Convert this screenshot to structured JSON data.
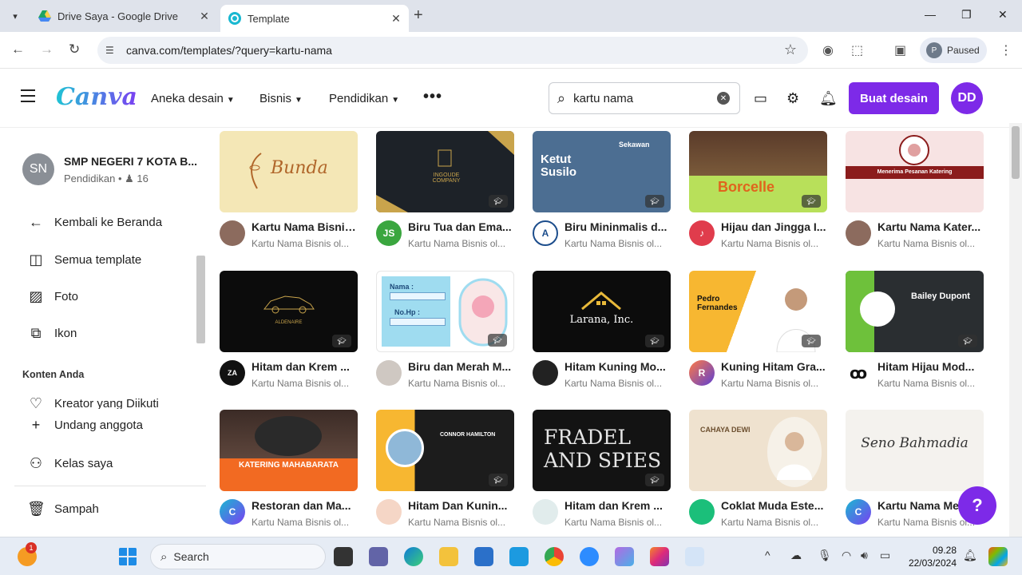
{
  "browser": {
    "tabs": [
      {
        "title": "Drive Saya - Google Drive",
        "active": false
      },
      {
        "title": "Template",
        "active": true
      }
    ],
    "url": "canva.com/templates/?query=kartu-nama",
    "profile_label": "Paused",
    "profile_initial": "P"
  },
  "header": {
    "logo": "Canva",
    "nav": [
      "Aneka desain",
      "Bisnis",
      "Pendidikan"
    ],
    "search_value": "kartu nama",
    "create_button": "Buat desain",
    "avatar_initials": "DD",
    "accent": "#7d2ae8"
  },
  "sidebar": {
    "team": {
      "initials": "SN",
      "name": "SMP NEGERI 7 KOTA B...",
      "type": "Pendidikan",
      "members": "16"
    },
    "items": [
      {
        "label": "Kembali ke Beranda",
        "icon": "arrow-left-icon"
      },
      {
        "label": "Semua template",
        "icon": "template-icon"
      },
      {
        "label": "Foto",
        "icon": "image-icon"
      },
      {
        "label": "Ikon",
        "icon": "shapes-icon"
      }
    ],
    "section_heading": "Konten Anda",
    "section_items": [
      {
        "label": "Kreator yang Diikuti",
        "icon": "heart-hands-icon"
      }
    ],
    "bottom_items": [
      {
        "label": "Undang anggota",
        "icon": "plus-icon"
      },
      {
        "label": "Kelas saya",
        "icon": "people-icon"
      },
      {
        "label": "Sampah",
        "icon": "trash-icon"
      }
    ]
  },
  "templates": [
    {
      "title": "Kartu Nama Bisnis...",
      "subtitle": "Kartu Nama Bisnis ol...",
      "thumb_text": "Bunda"
    },
    {
      "title": "Biru Tua dan Ema...",
      "subtitle": "Kartu Nama Bisnis ol...",
      "thumb_text": "INGOUDE COMPANY",
      "avatar": "JS"
    },
    {
      "title": "Biru Mininmalis d...",
      "subtitle": "Kartu Nama Bisnis ol...",
      "thumb_text": "Ketut Susilo",
      "thumb_text2": "Sekawan"
    },
    {
      "title": "Hijau dan Jingga I...",
      "subtitle": "Kartu Nama Bisnis ol...",
      "thumb_text": "Borcelle"
    },
    {
      "title": "Kartu Nama Kater...",
      "subtitle": "Kartu Nama Bisnis ol...",
      "thumb_text": "Menerima Pesanan Katering"
    },
    {
      "title": "Hitam dan Krem ...",
      "subtitle": "Kartu Nama Bisnis ol...",
      "thumb_text": "ALDENAIRE"
    },
    {
      "title": "Biru dan Merah M...",
      "subtitle": "Kartu Nama Bisnis ol...",
      "thumb_text": "Nama :",
      "thumb_text2": "No.Hp :"
    },
    {
      "title": "Hitam Kuning Mo...",
      "subtitle": "Kartu Nama Bisnis ol...",
      "thumb_text": "Larana, Inc."
    },
    {
      "title": "Kuning Hitam Gra...",
      "subtitle": "Kartu Nama Bisnis ol...",
      "thumb_text": "Pedro Fernandes"
    },
    {
      "title": "Hitam Hijau Mod...",
      "subtitle": "Kartu Nama Bisnis ol...",
      "thumb_text": "Bailey Dupont"
    },
    {
      "title": "Restoran dan Ma...",
      "subtitle": "Kartu Nama Bisnis ol...",
      "thumb_text": "KATERING MAHABARATA"
    },
    {
      "title": "Hitam Dan Kunin...",
      "subtitle": "Kartu Nama Bisnis ol...",
      "thumb_text": "CONNOR HAMILTON"
    },
    {
      "title": "Hitam dan Krem ...",
      "subtitle": "Kartu Nama Bisnis ol...",
      "thumb_text": "FRADEL AND SPIES"
    },
    {
      "title": "Coklat Muda Este...",
      "subtitle": "Kartu Nama Bisnis ol...",
      "thumb_text": "CAHAYA DEWI"
    },
    {
      "title": "Kartu Nama Me...",
      "subtitle": "Kartu Nama Bisnis ol...",
      "thumb_text": "Seno Bahmadia"
    }
  ],
  "help_label": "?",
  "taskbar": {
    "search_placeholder": "Search",
    "time": "09.28",
    "date": "22/03/2024",
    "notification_count": "1"
  }
}
